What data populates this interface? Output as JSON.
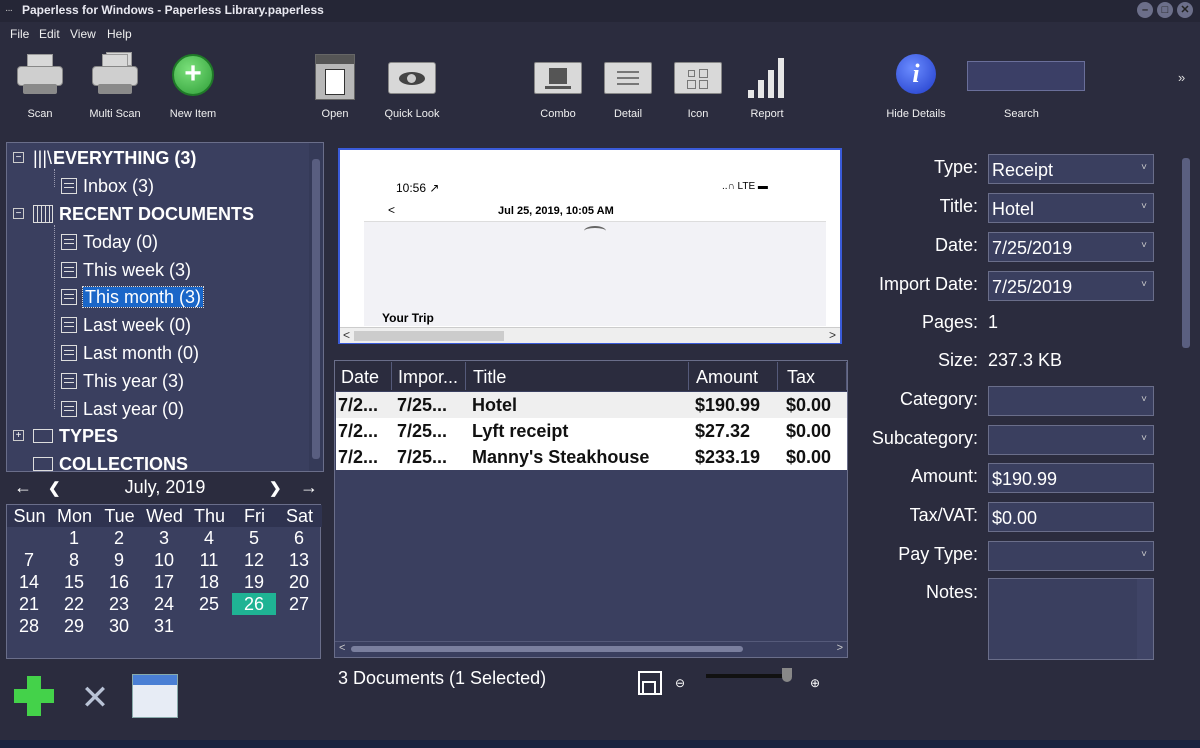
{
  "window": {
    "title": "Paperless for Windows - Paperless Library.paperless",
    "sysmenu": "···",
    "buttons": [
      "–",
      "□",
      "✕"
    ]
  },
  "menu": [
    "File",
    "Edit",
    "View",
    "Help"
  ],
  "toolbar": {
    "scan": "Scan",
    "multi_scan": "Multi Scan",
    "new_item": "New Item",
    "open": "Open",
    "quick_look": "Quick Look",
    "combo": "Combo",
    "detail": "Detail",
    "icon": "Icon",
    "report": "Report",
    "hide_details": "Hide Details",
    "search_label": "Search",
    "search_value": "",
    "overflow": "»"
  },
  "tree": {
    "everything": "EVERYTHING (3)",
    "inbox": "Inbox (3)",
    "recent": "RECENT DOCUMENTS",
    "items": [
      "Today (0)",
      "This week (3)",
      "This month (3)",
      "Last week (0)",
      "Last month (0)",
      "This year (3)",
      "Last year (0)"
    ],
    "selected_index": 2,
    "types": "TYPES",
    "collections": "COLLECTIONS"
  },
  "calendar": {
    "month": "July, 2019",
    "nav_first": "←",
    "nav_prev": "❮",
    "nav_next": "❯",
    "nav_last": "→",
    "dow": [
      "Sun",
      "Mon",
      "Tue",
      "Wed",
      "Thu",
      "Fri",
      "Sat"
    ],
    "weeks": [
      [
        "",
        "1",
        "2",
        "3",
        "4",
        "5",
        "6"
      ],
      [
        "7",
        "8",
        "9",
        "10",
        "11",
        "12",
        "13"
      ],
      [
        "14",
        "15",
        "16",
        "17",
        "18",
        "19",
        "20"
      ],
      [
        "21",
        "22",
        "23",
        "24",
        "25",
        "26",
        "27"
      ],
      [
        "28",
        "29",
        "30",
        "31",
        "",
        "",
        ""
      ]
    ],
    "today": "26"
  },
  "preview": {
    "time": "10:56 ↗",
    "signal": "..∩ LTE ▬",
    "back": "<",
    "date": "Jul 25, 2019, 10:05 AM",
    "trip": "Your Trip",
    "scroll_left": "<",
    "scroll_right": ">"
  },
  "table": {
    "columns": [
      "Date",
      "Impor...",
      "Title",
      "Amount",
      "Tax"
    ],
    "rows": [
      {
        "date": "7/2...",
        "import": "7/25...",
        "title": "Hotel",
        "amount": "$190.99",
        "tax": "$0.00"
      },
      {
        "date": "7/2...",
        "import": "7/25...",
        "title": "Lyft receipt",
        "amount": "$27.32",
        "tax": "$0.00"
      },
      {
        "date": "7/2...",
        "import": "7/25...",
        "title": "Manny's Steakhouse",
        "amount": "$233.19",
        "tax": "$0.00"
      }
    ],
    "selected_row": 0,
    "scroll_left": "<",
    "scroll_right": ">"
  },
  "status": {
    "text": "3 Documents (1 Selected)",
    "zoom_out": "⊖",
    "zoom_in": "⊕",
    "zoom_level": 0.92
  },
  "details": {
    "type_label": "Type:",
    "type_value": "Receipt",
    "title_label": "Title:",
    "title_value": "Hotel",
    "date_label": "Date:",
    "date_value": "7/25/2019",
    "import_label": "Import Date:",
    "import_value": "7/25/2019",
    "pages_label": "Pages:",
    "pages_value": "1",
    "size_label": "Size:",
    "size_value": "237.3 KB",
    "category_label": "Category:",
    "category_value": "",
    "subcategory_label": "Subcategory:",
    "subcategory_value": "",
    "amount_label": "Amount:",
    "amount_value": "$190.99",
    "tax_label": "Tax/VAT:",
    "tax_value": "$0.00",
    "paytype_label": "Pay Type:",
    "paytype_value": "",
    "notes_label": "Notes:",
    "notes_value": "",
    "dropdown_arrow": "˅"
  },
  "colors": {
    "background": "#2b2c3e",
    "panel": "#3a3f5f",
    "selection": "#1a66c8",
    "today": "#1fb394",
    "accent_green": "#44d24a"
  }
}
